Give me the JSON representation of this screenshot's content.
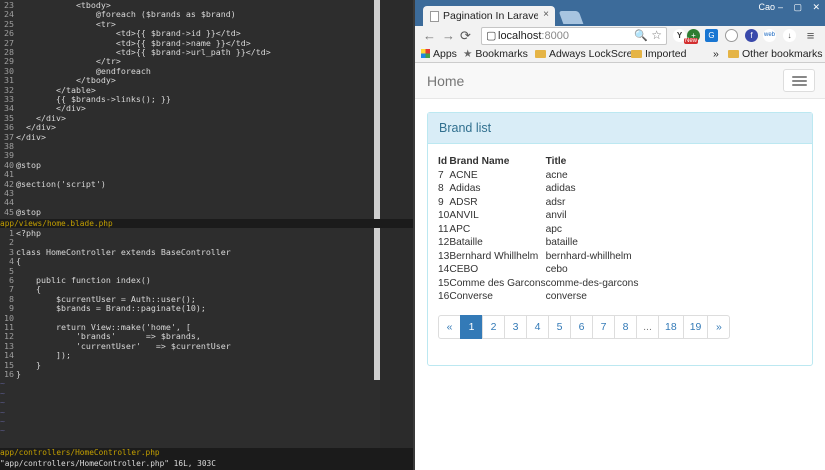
{
  "editor": {
    "top_lines": [
      {
        "n": "23",
        "t": "            <tbody>"
      },
      {
        "n": "24",
        "t": "                @foreach ($brands as $brand)"
      },
      {
        "n": "25",
        "t": "                <tr>"
      },
      {
        "n": "26",
        "t": "                    <td>{{ $brand->id }}</td>"
      },
      {
        "n": "27",
        "t": "                    <td>{{ $brand->name }}</td>"
      },
      {
        "n": "28",
        "t": "                    <td>{{ $brand->url_path }}</td>"
      },
      {
        "n": "29",
        "t": "                </tr>"
      },
      {
        "n": "30",
        "t": "                @endforeach"
      },
      {
        "n": "31",
        "t": "            </tbody>"
      },
      {
        "n": "32",
        "t": "        </table>"
      },
      {
        "n": "33",
        "t": "        {{ $brands->links(); }}"
      },
      {
        "n": "34",
        "t": "        </div>"
      },
      {
        "n": "35",
        "t": "    </div>"
      },
      {
        "n": "36",
        "t": "  </div>"
      },
      {
        "n": "37",
        "t": "</div>"
      },
      {
        "n": "38",
        "t": ""
      },
      {
        "n": "39",
        "t": ""
      },
      {
        "n": "40",
        "t": "@stop"
      },
      {
        "n": "41",
        "t": ""
      },
      {
        "n": "42",
        "t": "@section('script')"
      },
      {
        "n": "43",
        "t": ""
      },
      {
        "n": "44",
        "t": ""
      },
      {
        "n": "45",
        "t": "@stop"
      }
    ],
    "top_status": "app/views/home.blade.php",
    "bottom_lines": [
      {
        "n": "1",
        "t": "<?php"
      },
      {
        "n": "2",
        "t": ""
      },
      {
        "n": "3",
        "t": "class HomeController extends BaseController"
      },
      {
        "n": "4",
        "t": "{"
      },
      {
        "n": "5",
        "t": ""
      },
      {
        "n": "6",
        "t": "    public function index()"
      },
      {
        "n": "7",
        "t": "    {"
      },
      {
        "n": "8",
        "t": "        $currentUser = Auth::user();"
      },
      {
        "n": "9",
        "t": "        $brands = Brand::paginate(10);"
      },
      {
        "n": "10",
        "t": ""
      },
      {
        "n": "11",
        "t": "        return View::make('home', ["
      },
      {
        "n": "12",
        "t": "            'brands'      => $brands,"
      },
      {
        "n": "13",
        "t": "            'currentUser'   => $currentUser"
      },
      {
        "n": "14",
        "t": "        ]);"
      },
      {
        "n": "15",
        "t": "    }"
      },
      {
        "n": "16",
        "t": "}"
      }
    ],
    "tilde": "~",
    "bottom_status": "app/controllers/HomeController.php",
    "cmdline": "\"app/controllers/HomeController.php\" 16L, 303C"
  },
  "browser": {
    "tab_title": "Pagination In Laravel",
    "tab_close": "×",
    "window_user": "Cao",
    "window_buttons": "– ▢ ✕",
    "url_host": "localhost",
    "url_port": ":8000",
    "ext_badge": "New",
    "bookmarks": [
      "Apps",
      "Bookmarks",
      "Adways LockScre",
      "Imported"
    ],
    "bookmarks_overflow": "»",
    "other_bookmarks": "Other bookmarks",
    "page": {
      "brand": "Home",
      "panel_title": "Brand list",
      "columns": [
        "Id",
        "Brand Name",
        "Title"
      ],
      "rows": [
        [
          "7",
          "ACNE",
          "acne"
        ],
        [
          "8",
          "Adidas",
          "adidas"
        ],
        [
          "9",
          "ADSR",
          "adsr"
        ],
        [
          "10",
          "ANVIL",
          "anvil"
        ],
        [
          "11",
          "APC",
          "apc"
        ],
        [
          "12",
          "Bataille",
          "bataille"
        ],
        [
          "13",
          "Bernhard Whillhelm",
          "bernhard-whillhelm"
        ],
        [
          "14",
          "CEBO",
          "cebo"
        ],
        [
          "15",
          "Comme des Garcons",
          "comme-des-garcons"
        ],
        [
          "16",
          "Converse",
          "converse"
        ]
      ],
      "pagination": [
        "«",
        "1",
        "2",
        "3",
        "4",
        "5",
        "6",
        "7",
        "8",
        "...",
        "18",
        "19",
        "»"
      ],
      "active_page": "1"
    }
  },
  "colors": {
    "accent": "#337ab7",
    "panel_heading": "#d9edf7",
    "panel_text": "#31708f",
    "tabbar": "#3c6b9a",
    "editor_bg": "#2d2d2d"
  },
  "icons": {
    "back": "←",
    "forward": "→",
    "reload": "⟳",
    "page": "▢",
    "zoom": "🔍",
    "star": "☆",
    "menu": "≡"
  }
}
